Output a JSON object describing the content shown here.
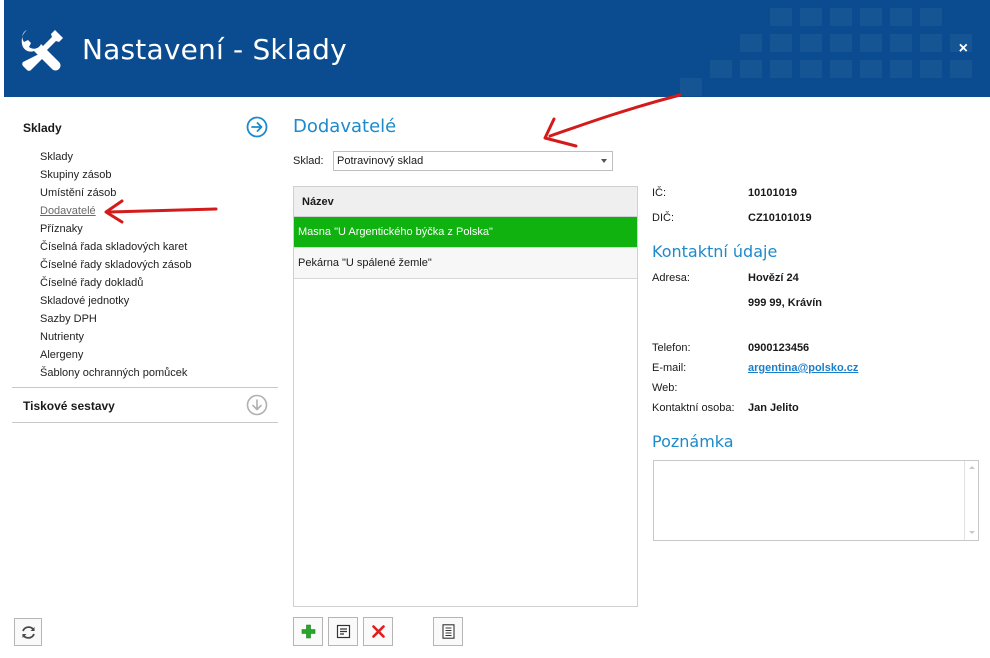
{
  "window": {
    "title": "Nastavení - Sklady",
    "close_label": "×"
  },
  "sidebar": {
    "sections": [
      {
        "label": "Sklady",
        "expanded": true
      },
      {
        "label": "Tiskové sestavy",
        "expanded": false
      }
    ],
    "items": [
      {
        "label": "Sklady"
      },
      {
        "label": "Skupiny zásob"
      },
      {
        "label": "Umístění zásob"
      },
      {
        "label": "Dodavatelé",
        "active": true
      },
      {
        "label": "Příznaky"
      },
      {
        "label": "Číselná řada skladových karet"
      },
      {
        "label": "Číselné řady skladových zásob"
      },
      {
        "label": "Číselné řady dokladů"
      },
      {
        "label": "Skladové jednotky"
      },
      {
        "label": "Sazby DPH"
      },
      {
        "label": "Nutrienty"
      },
      {
        "label": "Alergeny"
      },
      {
        "label": "Šablony ochranných pomůcek"
      }
    ]
  },
  "main": {
    "title": "Dodavatelé",
    "sklad_label": "Sklad:",
    "sklad_value": "Potravinový sklad",
    "list": {
      "column": "Název",
      "rows": [
        {
          "name": "Masna \"U Argentického býčka z Polska\"",
          "selected": true
        },
        {
          "name": "Pekárna \"U spálené žemle\"",
          "selected": false
        }
      ]
    }
  },
  "detail": {
    "ic_label": "IČ:",
    "ic_value": "10101019",
    "dic_label": "DIČ:",
    "dic_value": "CZ10101019",
    "contacts_title": "Kontaktní údaje",
    "adresa_label": "Adresa:",
    "adresa_line1": "Hovězí 24",
    "adresa_line2": "999 99, Krávín",
    "telefon_label": "Telefon:",
    "telefon_value": "0900123456",
    "email_label": "E-mail:",
    "email_value": "argentina@polsko.cz",
    "web_label": "Web:",
    "osoba_label": "Kontaktní osoba:",
    "osoba_value": "Jan Jelito",
    "note_title": "Poznámka"
  },
  "colors": {
    "header": "#0a4c8f",
    "accent": "#1c8acb",
    "selected_row": "#0fb20f",
    "arrow": "#d41b1b"
  },
  "icons": {
    "tools": "wrench-screwdriver-icon",
    "add": "plus-icon",
    "edit": "edit-icon",
    "delete": "delete-icon",
    "report": "document-icon",
    "refresh": "refresh-icon"
  }
}
